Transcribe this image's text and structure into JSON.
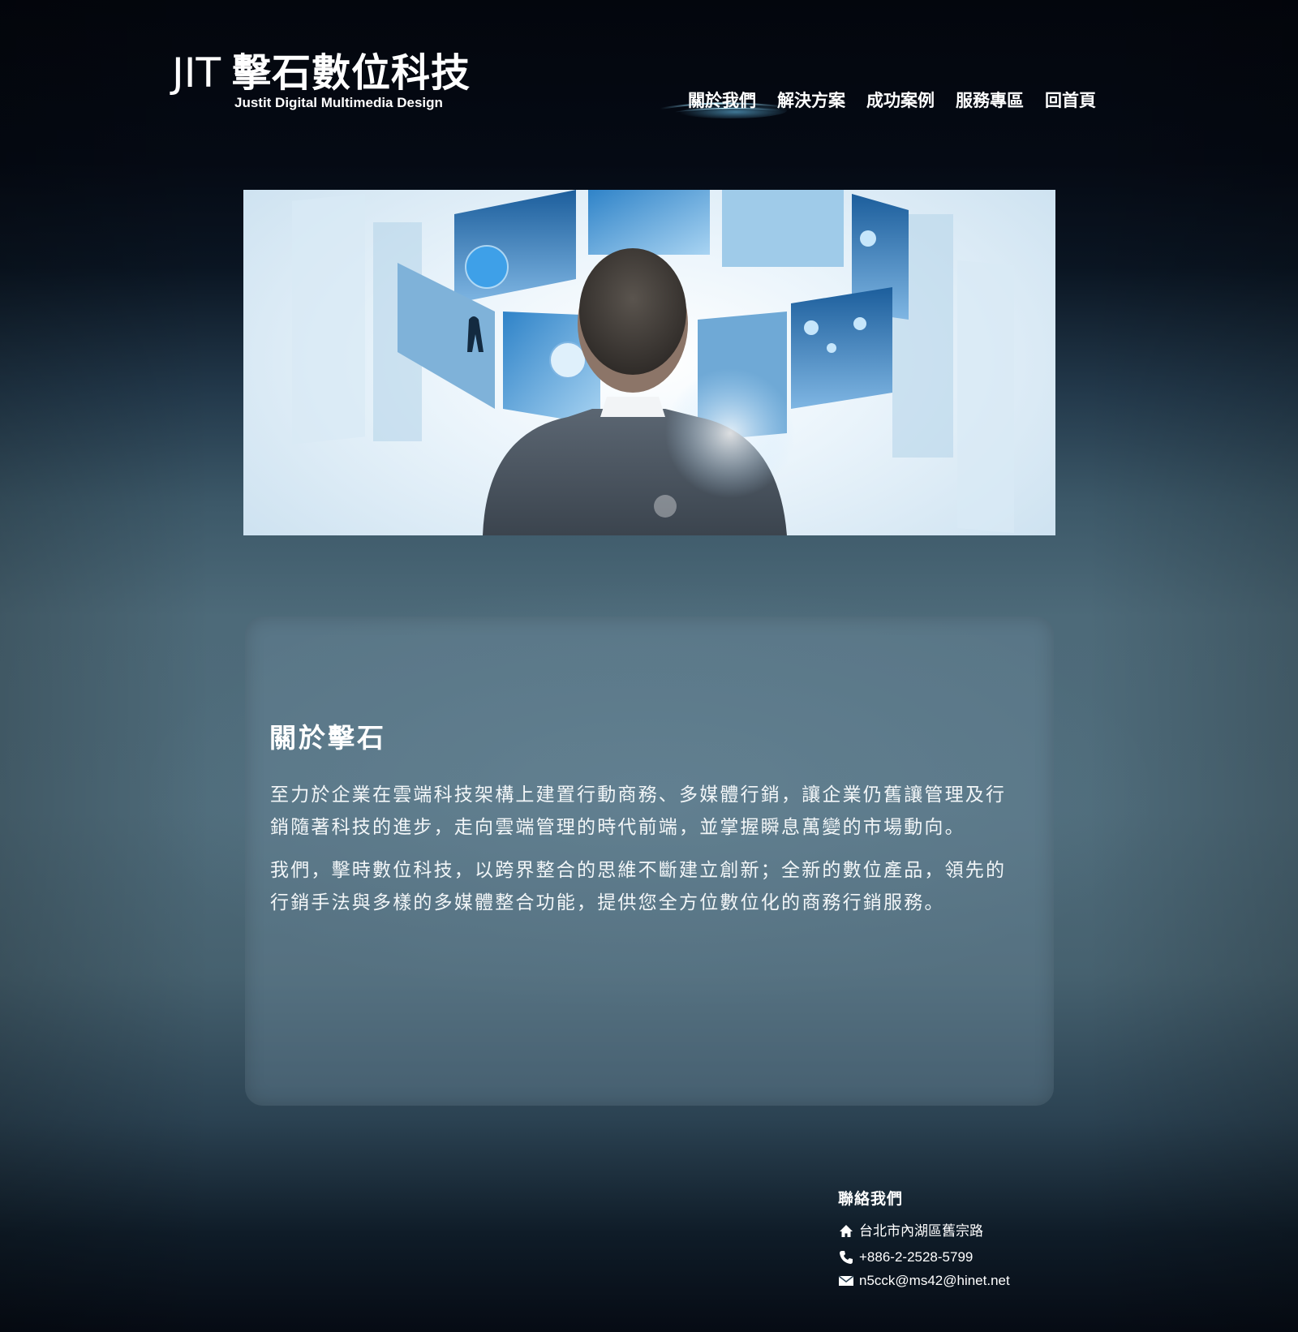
{
  "header": {
    "logo_mark": "JIT",
    "logo_name": "擊石數位科技",
    "logo_subtitle": "Justit  Digital Multimedia Design"
  },
  "nav": {
    "items": [
      {
        "label": "關於我們",
        "active": true
      },
      {
        "label": "解決方案",
        "active": false
      },
      {
        "label": "成功案例",
        "active": false
      },
      {
        "label": "服務專區",
        "active": false
      },
      {
        "label": "回首頁",
        "active": false
      }
    ]
  },
  "about": {
    "title": "關於擊石",
    "paragraphs": [
      "至力於企業在雲端科技架構上建置行動商務、多媒體行銷，讓企業仍舊讓管理及行銷隨著科技的進步，走向雲端管理的時代前端，並掌握瞬息萬變的市場動向。",
      "我們，擊時數位科技，以跨界整合的思維不斷建立創新；全新的數位產品，領先的行銷手法與多樣的多媒體整合功能，提供您全方位數位化的商務行銷服務。"
    ]
  },
  "contact": {
    "title": "聯絡我們",
    "address": "台北市內湖區舊宗路",
    "phone": "+886-2-2528-5799",
    "email": "n5cck@ms42@hinet.net",
    "icons": {
      "address": "home-icon",
      "phone": "phone-icon",
      "email": "mail-icon"
    }
  },
  "colors": {
    "background_top": "#03060d",
    "background_mid": "#4d6a79",
    "accent_glow": "#7fd3ff",
    "panel": "#6e8c9e"
  }
}
